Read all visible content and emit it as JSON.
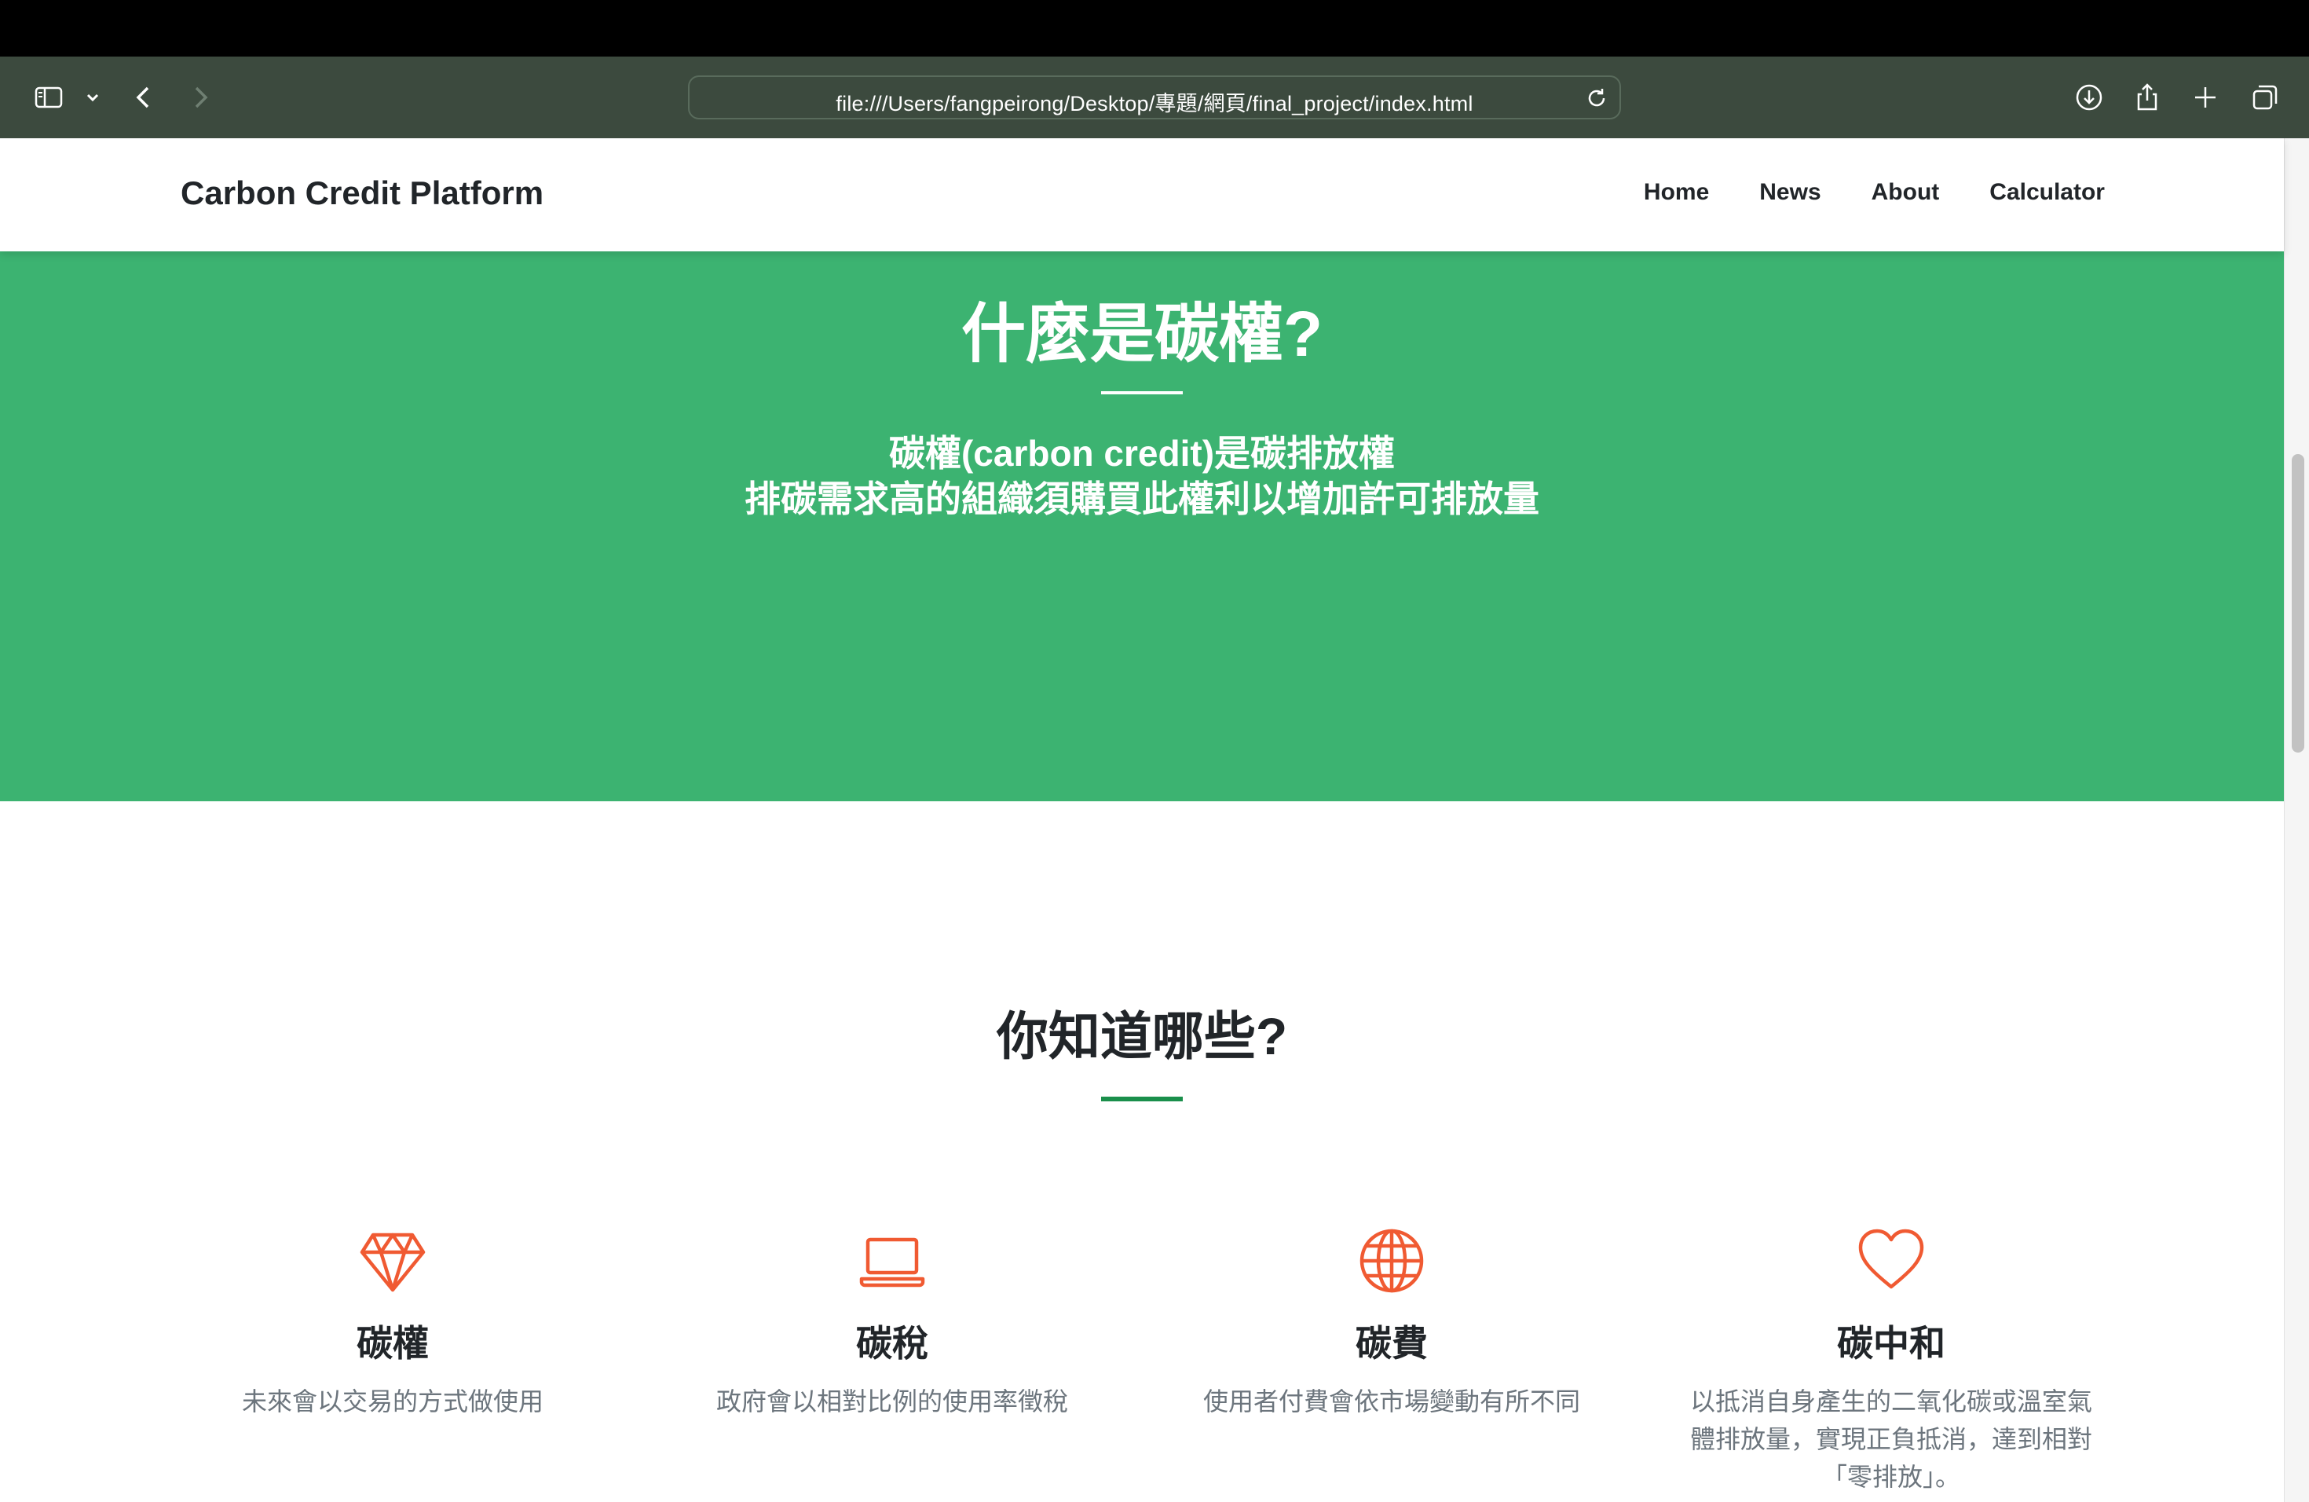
{
  "browser": {
    "url": "file:///Users/fangpeirong/Desktop/專題/網頁/final_project/index.html"
  },
  "site": {
    "brand": "Carbon Credit Platform",
    "nav": [
      "Home",
      "News",
      "About",
      "Calculator"
    ]
  },
  "hero": {
    "title": "什麼是碳權?",
    "line1": "碳權(carbon credit)是碳排放權",
    "line2": "排碳需求高的組織須購買此權利以增加許可排放量"
  },
  "section": {
    "title": "你知道哪些?",
    "features": [
      {
        "icon": "diamond-icon",
        "title": "碳權",
        "desc": "未來會以交易的方式做使用"
      },
      {
        "icon": "laptop-icon",
        "title": "碳稅",
        "desc": "政府會以相對比例的使用率徵稅"
      },
      {
        "icon": "globe-icon",
        "title": "碳費",
        "desc": "使用者付費會依市場變動有所不同"
      },
      {
        "icon": "heart-icon",
        "title": "碳中和",
        "desc": "以抵消自身產生的二氧化碳或溫室氣體排放量，實現正負抵消，達到相對「零排放」。"
      }
    ]
  },
  "colors": {
    "hero_bg": "#3cb371",
    "accent_rule": "#1a8f4b",
    "icon": "#f05a32",
    "toolbar": "#3c4a3e"
  }
}
